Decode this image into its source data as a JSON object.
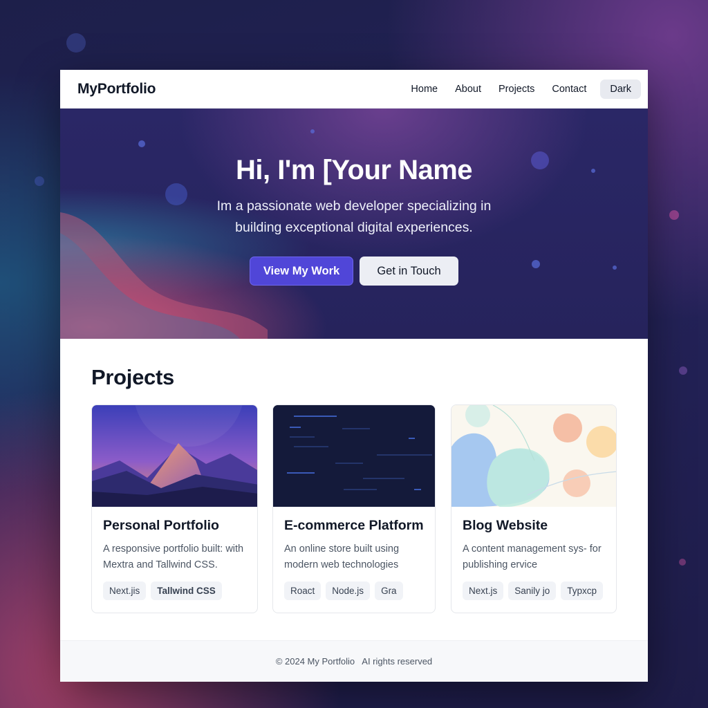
{
  "nav": {
    "brand": "MyPortfolio",
    "links": [
      "Home",
      "About",
      "Projects",
      "Contact"
    ],
    "theme_toggle": "Dark"
  },
  "hero": {
    "title": "Hi, I'm [Your Name",
    "subtitle": "Im a passionate web developer specializing in building exceptional digital experiences.",
    "primary_button": "View My Work",
    "secondary_button": "Get in Touch"
  },
  "projects": {
    "heading": "Projects",
    "items": [
      {
        "title": "Personal Portfolio",
        "description": "A responsive portfolio built: with Mextra and Tallwind CSS.",
        "tags": [
          "Next.jis",
          "Tallwind CSS"
        ],
        "thumbnail": "mountain-illustration"
      },
      {
        "title": "E-commerce Platform",
        "description": "An online store built using modern web technologies",
        "tags": [
          "Roact",
          "Node.js",
          "Gra"
        ],
        "thumbnail": "dark-code-lines"
      },
      {
        "title": "Blog Website",
        "description": "A content management sys- for publishing ervice",
        "tags": [
          "Next.js",
          "Sanily jo",
          "Typxcp"
        ],
        "thumbnail": "pastel-blobs"
      }
    ]
  },
  "footer": {
    "text": "© 2024 My Portfolio   AI rights reserved"
  },
  "colors": {
    "accent": "#5046d8",
    "hero_bg": "#26235c",
    "page_bg": "#1d1f4a"
  }
}
